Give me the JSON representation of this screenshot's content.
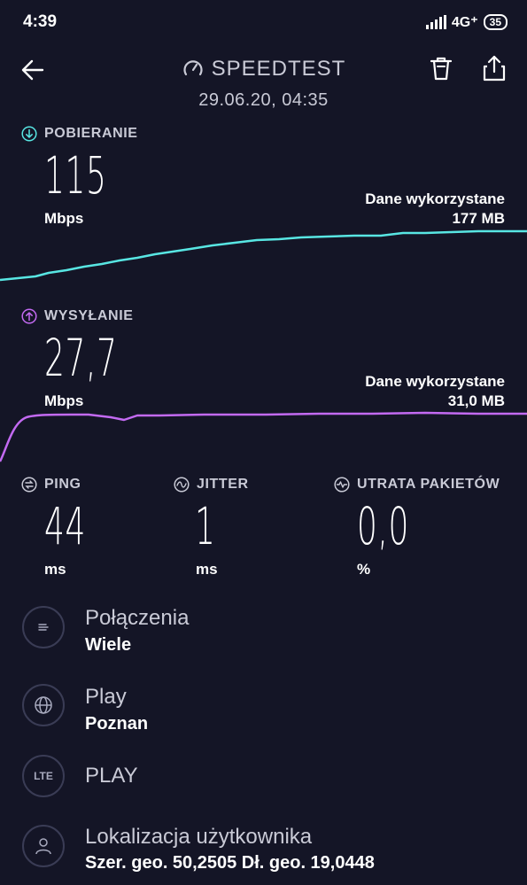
{
  "status_bar": {
    "time": "4:39",
    "network": "4G⁺",
    "battery": "35"
  },
  "header": {
    "title": "SPEEDTEST",
    "date": "29.06.20, 04:35"
  },
  "download": {
    "label": "POBIERANIE",
    "value": "115",
    "unit": "Mbps",
    "used_label": "Dane wykorzystane",
    "used_value": "177 MB",
    "color": "#58e6e3"
  },
  "upload": {
    "label": "WYSYŁANIE",
    "value": "27,7",
    "unit": "Mbps",
    "used_label": "Dane wykorzystane",
    "used_value": "31,0 MB",
    "color": "#c36af2"
  },
  "metrics": [
    {
      "label": "PING",
      "value": "44",
      "unit": "ms"
    },
    {
      "label": "JITTER",
      "value": "1",
      "unit": "ms"
    },
    {
      "label": "UTRATA PAKIETÓW",
      "value": "0,0",
      "unit": "%"
    }
  ],
  "details": [
    {
      "icon": "connections-icon",
      "title": "Połączenia",
      "subtitle": "Wiele"
    },
    {
      "icon": "globe-icon",
      "title": "Play",
      "subtitle": "Poznan"
    },
    {
      "icon": "lte-icon",
      "icon_text": "LTE",
      "title": "PLAY",
      "subtitle": ""
    },
    {
      "icon": "user-icon",
      "title": "Lokalizacja użytkownika",
      "subtitle": "Szer. geo. 50,2505 Dł. geo. 19,0448"
    }
  ]
}
